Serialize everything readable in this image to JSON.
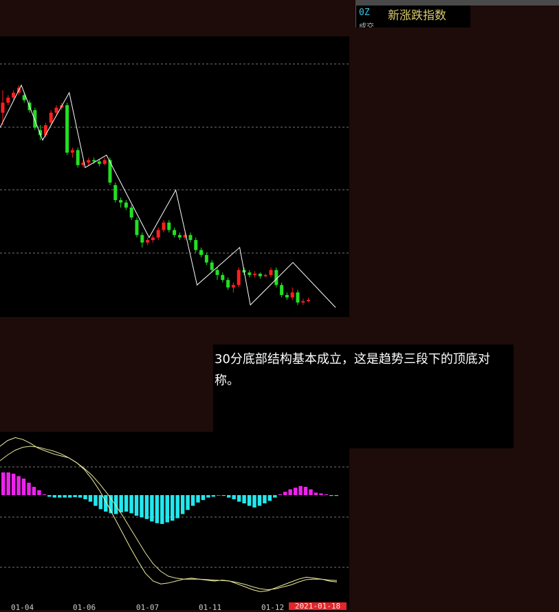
{
  "header": {
    "code": "0Z",
    "title": "新涨跌指数",
    "sub_label": "成交"
  },
  "note": {
    "text": "30分底部结构基本成立，这是趋势三段下的顶底对称。"
  },
  "x_axis": {
    "labels": [
      "01-04",
      "01-06",
      "01-07",
      "01-11",
      "01-12"
    ],
    "current_date": "2021-01-18"
  },
  "colors": {
    "up": "#ff2020",
    "down": "#22e022",
    "zigzag": "#ffffff",
    "grid": "#777777",
    "macd_pos": "#ee22ee",
    "macd_neg": "#22e8ee",
    "dif": "#f4f2a0",
    "dea": "#e8e8a0",
    "note_bg": "#000000"
  },
  "candles": [
    [
      0.72,
      0.8,
      0.62,
      0.9
    ],
    [
      0.8,
      0.84,
      0.78,
      0.86
    ],
    [
      0.84,
      0.88,
      0.82,
      0.9
    ],
    [
      0.88,
      0.92,
      0.86,
      0.94
    ],
    [
      0.86,
      0.82,
      0.8,
      0.88
    ],
    [
      0.8,
      0.74,
      0.72,
      0.82
    ],
    [
      0.74,
      0.6,
      0.58,
      0.76
    ],
    [
      0.58,
      0.54,
      0.5,
      0.62
    ],
    [
      0.54,
      0.62,
      0.52,
      0.64
    ],
    [
      0.64,
      0.72,
      0.62,
      0.74
    ],
    [
      0.72,
      0.76,
      0.7,
      0.78
    ],
    [
      0.76,
      0.78,
      0.74,
      0.8
    ],
    [
      0.78,
      0.4,
      0.38,
      0.8
    ],
    [
      0.4,
      0.42,
      0.36,
      0.44
    ],
    [
      0.42,
      0.3,
      0.28,
      0.44
    ],
    [
      0.3,
      0.32,
      0.28,
      0.34
    ],
    [
      0.32,
      0.34,
      0.3,
      0.36
    ],
    [
      0.34,
      0.33,
      0.31,
      0.36
    ],
    [
      0.33,
      0.31,
      0.29,
      0.35
    ],
    [
      0.31,
      0.34,
      0.3,
      0.36
    ],
    [
      0.34,
      0.16,
      0.14,
      0.36
    ],
    [
      0.14,
      0.02,
      0.0,
      0.16
    ],
    [
      0.02,
      0.0,
      -0.04,
      0.04
    ],
    [
      0.0,
      -0.04,
      -0.06,
      0.02
    ],
    [
      -0.04,
      -0.12,
      -0.14,
      -0.02
    ],
    [
      -0.14,
      -0.26,
      -0.28,
      -0.12
    ],
    [
      -0.26,
      -0.32,
      -0.36,
      -0.24
    ],
    [
      -0.32,
      -0.3,
      -0.34,
      -0.28
    ],
    [
      -0.3,
      -0.28,
      -0.32,
      -0.26
    ],
    [
      -0.28,
      -0.22,
      -0.3,
      -0.2
    ],
    [
      -0.22,
      -0.16,
      -0.24,
      -0.14
    ],
    [
      -0.16,
      -0.22,
      -0.24,
      -0.14
    ],
    [
      -0.22,
      -0.26,
      -0.28,
      -0.2
    ],
    [
      -0.26,
      -0.28,
      -0.3,
      -0.24
    ],
    [
      -0.28,
      -0.26,
      -0.3,
      -0.24
    ],
    [
      -0.26,
      -0.3,
      -0.32,
      -0.24
    ],
    [
      -0.3,
      -0.38,
      -0.4,
      -0.28
    ],
    [
      -0.38,
      -0.42,
      -0.44,
      -0.36
    ],
    [
      -0.42,
      -0.48,
      -0.5,
      -0.4
    ],
    [
      -0.48,
      -0.54,
      -0.56,
      -0.46
    ],
    [
      -0.54,
      -0.58,
      -0.62,
      -0.52
    ],
    [
      -0.58,
      -0.62,
      -0.64,
      -0.56
    ],
    [
      -0.62,
      -0.68,
      -0.7,
      -0.6
    ],
    [
      -0.68,
      -0.66,
      -0.72,
      -0.64
    ],
    [
      -0.66,
      -0.54,
      -0.68,
      -0.52
    ],
    [
      -0.54,
      -0.56,
      -0.58,
      -0.52
    ],
    [
      -0.56,
      -0.58,
      -0.6,
      -0.54
    ],
    [
      -0.58,
      -0.57,
      -0.6,
      -0.55
    ],
    [
      -0.57,
      -0.59,
      -0.61,
      -0.56
    ],
    [
      -0.59,
      -0.58,
      -0.6,
      -0.57
    ],
    [
      -0.58,
      -0.54,
      -0.6,
      -0.52
    ],
    [
      -0.54,
      -0.66,
      -0.68,
      -0.52
    ],
    [
      -0.66,
      -0.74,
      -0.76,
      -0.64
    ],
    [
      -0.74,
      -0.76,
      -0.78,
      -0.72
    ],
    [
      -0.76,
      -0.72,
      -0.78,
      -0.68
    ],
    [
      -0.72,
      -0.8,
      -0.82,
      -0.7
    ],
    [
      -0.8,
      -0.79,
      -0.82,
      -0.77
    ],
    [
      -0.79,
      -0.78,
      -0.8,
      -0.76
    ]
  ],
  "zigzag": [
    [
      0,
      0.6
    ],
    [
      4,
      0.94
    ],
    [
      8,
      0.5
    ],
    [
      13,
      0.88
    ],
    [
      16,
      0.28
    ],
    [
      20,
      0.38
    ],
    [
      28,
      -0.28
    ],
    [
      33,
      0.1
    ],
    [
      37,
      -0.66
    ],
    [
      45,
      -0.36
    ],
    [
      47,
      -0.82
    ],
    [
      55,
      -0.48
    ],
    [
      63,
      -0.84
    ]
  ],
  "macd_hist": [
    0.55,
    0.55,
    0.52,
    0.46,
    0.4,
    0.3,
    0.2,
    0.12,
    0.02,
    -0.04,
    -0.06,
    -0.06,
    -0.06,
    -0.06,
    -0.05,
    -0.06,
    -0.1,
    -0.16,
    -0.26,
    -0.34,
    -0.4,
    -0.44,
    -0.46,
    -0.42,
    -0.4,
    -0.44,
    -0.5,
    -0.54,
    -0.58,
    -0.64,
    -0.68,
    -0.7,
    -0.66,
    -0.62,
    -0.56,
    -0.46,
    -0.36,
    -0.26,
    -0.18,
    -0.12,
    -0.06,
    -0.04,
    0.0,
    -0.02,
    -0.06,
    -0.1,
    -0.16,
    -0.2,
    -0.26,
    -0.3,
    -0.26,
    -0.2,
    -0.14,
    -0.06,
    0.02,
    0.08,
    0.14,
    0.18,
    0.22,
    0.2,
    0.14,
    0.06,
    0.04,
    0.02,
    -0.02,
    -0.02
  ],
  "dif": [
    1.3,
    1.42,
    1.48,
    1.44,
    1.36,
    1.26,
    1.2,
    1.14,
    1.1,
    1.06,
    0.96,
    0.82,
    0.62,
    0.38,
    0.1,
    -0.2,
    -0.5,
    -0.8,
    -1.08,
    -1.34,
    -1.5,
    -1.56,
    -1.54,
    -1.5,
    -1.46,
    -1.44,
    -1.46,
    -1.48,
    -1.5,
    -1.48,
    -1.5,
    -1.56,
    -1.62,
    -1.68,
    -1.72,
    -1.7,
    -1.64,
    -1.58,
    -1.52,
    -1.46,
    -1.42,
    -1.44,
    -1.46,
    -1.5,
    -1.52
  ],
  "dea": [
    1.0,
    1.12,
    1.22,
    1.28,
    1.3,
    1.28,
    1.24,
    1.2,
    1.14,
    1.06,
    0.96,
    0.84,
    0.7,
    0.52,
    0.32,
    0.1,
    -0.14,
    -0.4,
    -0.66,
    -0.92,
    -1.14,
    -1.3,
    -1.4,
    -1.44,
    -1.46,
    -1.46,
    -1.46,
    -1.47,
    -1.48,
    -1.49,
    -1.5,
    -1.53,
    -1.57,
    -1.62,
    -1.66,
    -1.68,
    -1.66,
    -1.62,
    -1.58,
    -1.52,
    -1.47,
    -1.46,
    -1.46,
    -1.48,
    -1.49
  ]
}
